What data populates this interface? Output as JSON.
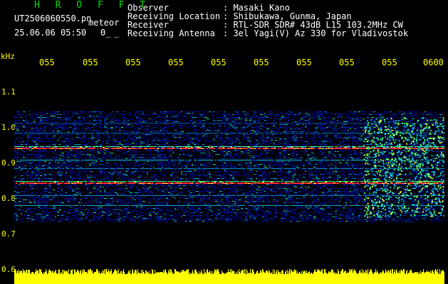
{
  "header": {
    "logo": "H R O F F T",
    "filename": "UT2506060550.pn",
    "tag": "meteor",
    "datetime": "25.06.06 05:50",
    "zero_label": "0_",
    "underscore_label": "_"
  },
  "info": {
    "labels": [
      "Observer",
      "Receiving Location",
      "Receiver",
      "Receiving Antenna"
    ],
    "values": [
      ": Masaki Kano",
      ": Shibukawa, Gunma, Japan",
      ": RTL-SDR SDR# 43dB L15 103.2MHz CW",
      ": 3el Yagi(V) Az 330 for Vladivostok"
    ]
  },
  "axis": {
    "unit": "kHz",
    "y_ticks": [
      "1.1",
      "1.0",
      "0.9",
      "0.8",
      "0.7",
      "0.6"
    ],
    "x_ticks": [
      "055",
      "055",
      "055",
      "055",
      "055",
      "055",
      "055",
      "055",
      "055",
      "0600"
    ]
  },
  "colors": {
    "background": "#000000",
    "axis_text": "#ffff00",
    "info_text": "#ffffff",
    "logo": "#00e000",
    "spectrum_low": "#0000c8",
    "spectrum_mid": "#00c8c8",
    "spectrum_high": "#ff2020",
    "power_bar": "#ffff00"
  }
}
